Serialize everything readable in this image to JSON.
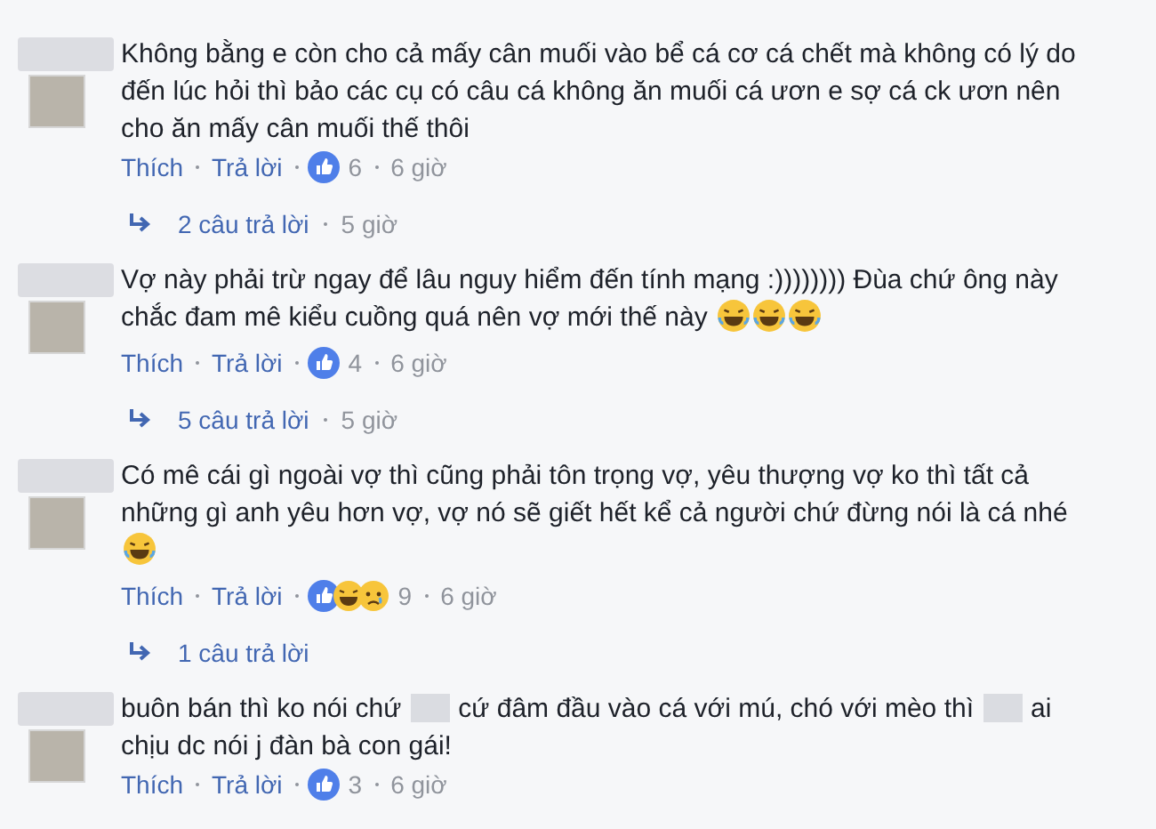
{
  "comments": [
    {
      "text_parts": [
        "Không bằng e còn cho cả mấy cân muối vào bể cá cơ cá chết mà không có lý do đến lúc hỏi thì bảo các cụ có câu cá không ăn muối cá ươn e sợ cá ck ươn nên cho ăn mấy cân muối thế thôi"
      ],
      "like": "Thích",
      "reply": "Trả lời",
      "reactions": [
        {
          "kind": "like"
        }
      ],
      "count": "6",
      "time": "6 giờ",
      "replies": {
        "label": "2 câu trả lời",
        "time": "5 giờ"
      }
    },
    {
      "text_parts": [
        "Vợ này phải trừ ngay để lâu nguy hiểm đến tính mạng :)))))))) Đùa chứ ông này chắc đam mê kiểu cuồng quá nên vợ mới thế này"
      ],
      "trailing_icons": [
        {
          "kind": "laugh"
        },
        {
          "kind": "laugh"
        },
        {
          "kind": "laugh"
        }
      ],
      "like": "Thích",
      "reply": "Trả lời",
      "reactions": [
        {
          "kind": "like"
        }
      ],
      "count": "4",
      "time": "6 giờ",
      "replies": {
        "label": "5 câu trả lời",
        "time": "5 giờ"
      }
    },
    {
      "text_parts": [
        "Có mê cái gì ngoài vợ thì cũng phải tôn trọng vợ, yêu thượng vợ ko thì tất cả những gì anh yêu hơn vợ, vợ nó sẽ giết hết kể cả người chứ đừng nói là cá nhé"
      ],
      "trailing_icons": [
        {
          "kind": "laugh"
        }
      ],
      "like": "Thích",
      "reply": "Trả lời",
      "reactions": [
        {
          "kind": "like"
        },
        {
          "kind": "haha"
        },
        {
          "kind": "sad"
        }
      ],
      "count": "9",
      "time": "6 giờ",
      "replies": {
        "label": "1 câu trả lời"
      }
    },
    {
      "text_parts": [
        "buôn bán thì ko nói chứ",
        "cứ đâm đầu vào cá với mú, chó với mèo thì",
        "ai chịu dc nói j đàn bà con gái!"
      ],
      "like": "Thích",
      "reply": "Trả lời",
      "reactions": [
        {
          "kind": "like"
        }
      ],
      "count": "3",
      "time": "6 giờ"
    }
  ]
}
